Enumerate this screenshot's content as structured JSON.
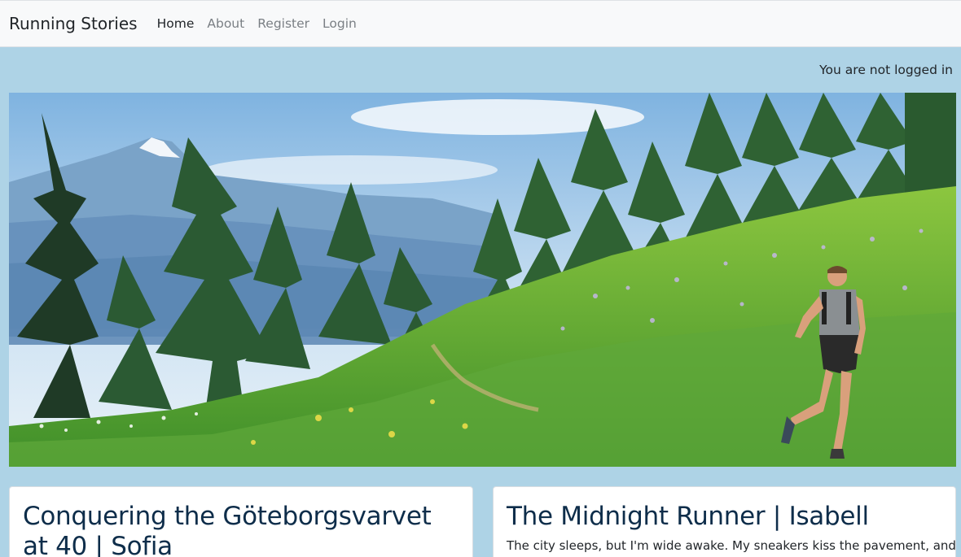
{
  "navbar": {
    "brand": "Running Stories",
    "links": [
      {
        "label": "Home",
        "active": true
      },
      {
        "label": "About",
        "active": false
      },
      {
        "label": "Register",
        "active": false
      },
      {
        "label": "Login",
        "active": false
      }
    ]
  },
  "status": {
    "login_text": "You are not logged in"
  },
  "hero": {
    "image": "trail-runner-mountain-meadow"
  },
  "stories": [
    {
      "title": "Conquering the Göteborgsvarvet at 40 | Sofia",
      "excerpt": ""
    },
    {
      "title": "The Midnight Runner | Isabell",
      "excerpt": "The city sleeps, but I'm wide awake. My sneakers kiss the pavement, and the"
    }
  ],
  "colors": {
    "page_background": "#aed3e6",
    "navbar_background": "#f8f9fa",
    "card_title": "#0e2d4a"
  }
}
